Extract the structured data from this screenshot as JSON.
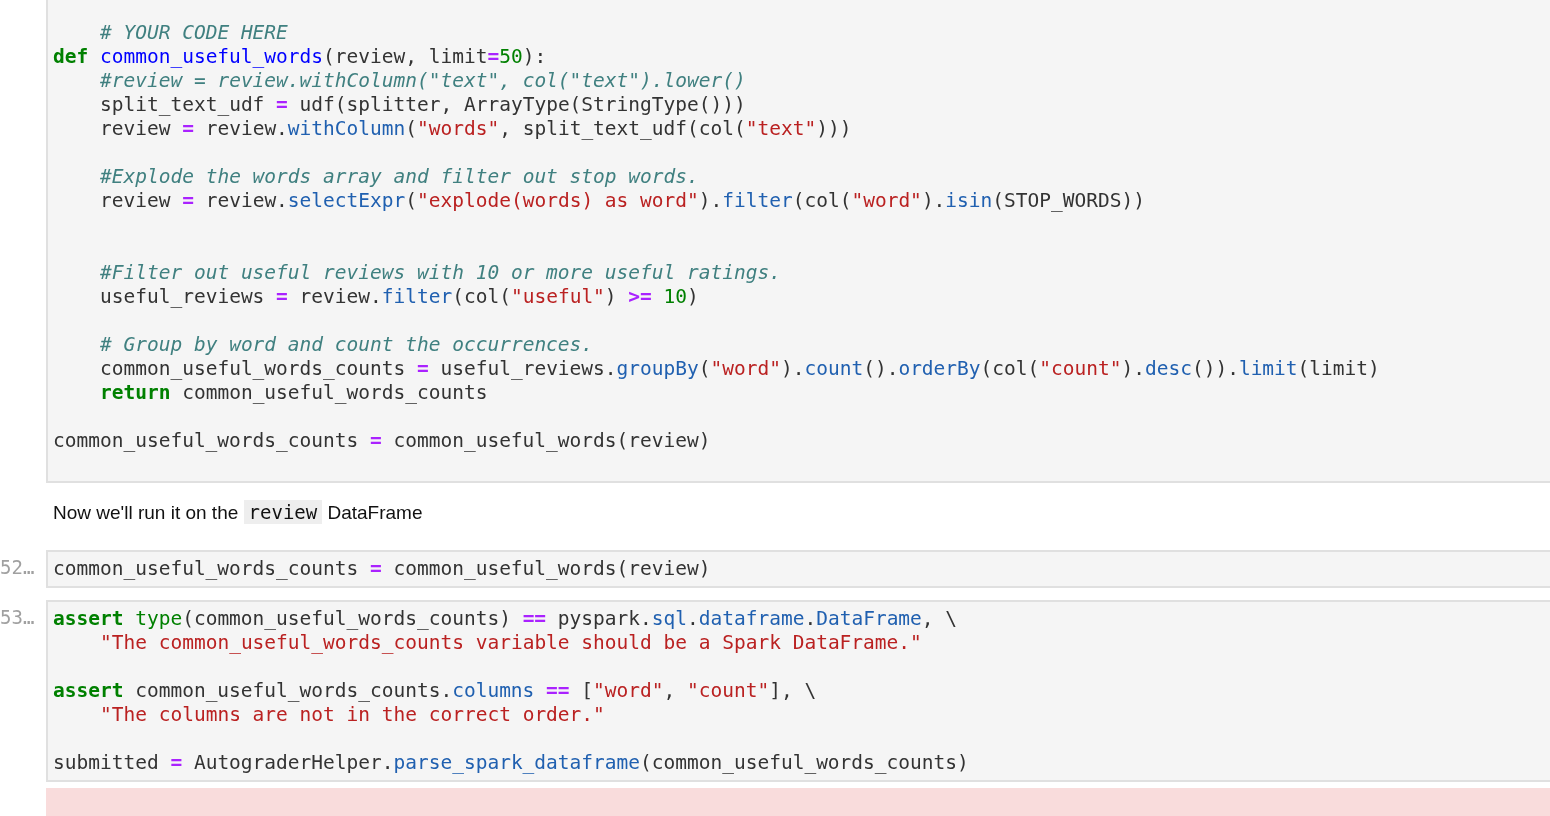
{
  "cells": [
    {
      "kind": "code",
      "lines": [
        {
          "kind": "indented",
          "tokens": [
            {
              "kind": "cmt",
              "text": "# YOUR CODE HERE"
            }
          ]
        },
        {
          "kind": "code",
          "tokens": [
            {
              "kind": "kw",
              "text": "def "
            },
            {
              "kind": "fn",
              "text": "common_useful_words"
            },
            {
              "kind": "plain",
              "text": "(review, limit"
            },
            {
              "kind": "op",
              "text": "="
            },
            {
              "kind": "num",
              "text": "50"
            },
            {
              "kind": "plain",
              "text": "):"
            }
          ]
        },
        {
          "kind": "indented",
          "tokens": [
            {
              "kind": "cmt",
              "text": "#review = review.withColumn(\"text\", col(\"text\").lower()"
            }
          ]
        },
        {
          "kind": "indented",
          "tokens": [
            {
              "kind": "plain",
              "text": "split_text_udf "
            },
            {
              "kind": "op",
              "text": "="
            },
            {
              "kind": "plain",
              "text": " udf(splitter, ArrayType(StringType()))"
            }
          ]
        },
        {
          "kind": "indented",
          "tokens": [
            {
              "kind": "plain",
              "text": "review "
            },
            {
              "kind": "op",
              "text": "="
            },
            {
              "kind": "plain",
              "text": " review."
            },
            {
              "kind": "attr",
              "text": "withColumn"
            },
            {
              "kind": "plain",
              "text": "("
            },
            {
              "kind": "str",
              "text": "\"words\""
            },
            {
              "kind": "plain",
              "text": ", split_text_udf(col("
            },
            {
              "kind": "str",
              "text": "\"text\""
            },
            {
              "kind": "plain",
              "text": ")))"
            }
          ]
        },
        {
          "kind": "blank"
        },
        {
          "kind": "indented",
          "tokens": [
            {
              "kind": "cmt",
              "text": "#Explode the words array and filter out stop words."
            }
          ]
        },
        {
          "kind": "indented",
          "tokens": [
            {
              "kind": "plain",
              "text": "review "
            },
            {
              "kind": "op",
              "text": "="
            },
            {
              "kind": "plain",
              "text": " review."
            },
            {
              "kind": "attr",
              "text": "selectExpr"
            },
            {
              "kind": "plain",
              "text": "("
            },
            {
              "kind": "str",
              "text": "\"explode(words) as word\""
            },
            {
              "kind": "plain",
              "text": ")."
            },
            {
              "kind": "attr",
              "text": "filter"
            },
            {
              "kind": "plain",
              "text": "(col("
            },
            {
              "kind": "str",
              "text": "\"word\""
            },
            {
              "kind": "plain",
              "text": ")."
            },
            {
              "kind": "attr",
              "text": "isin"
            },
            {
              "kind": "plain",
              "text": "(STOP_WORDS))"
            }
          ]
        },
        {
          "kind": "blank"
        },
        {
          "kind": "blank"
        },
        {
          "kind": "indented",
          "tokens": [
            {
              "kind": "cmt",
              "text": "#Filter out useful reviews with 10 or more useful ratings."
            }
          ]
        },
        {
          "kind": "indented",
          "tokens": [
            {
              "kind": "plain",
              "text": "useful_reviews "
            },
            {
              "kind": "op",
              "text": "="
            },
            {
              "kind": "plain",
              "text": " review."
            },
            {
              "kind": "attr",
              "text": "filter"
            },
            {
              "kind": "plain",
              "text": "(col("
            },
            {
              "kind": "str",
              "text": "\"useful\""
            },
            {
              "kind": "plain",
              "text": ") "
            },
            {
              "kind": "op",
              "text": ">= "
            },
            {
              "kind": "num",
              "text": "10"
            },
            {
              "kind": "plain",
              "text": ")"
            }
          ]
        },
        {
          "kind": "blank"
        },
        {
          "kind": "indented",
          "tokens": [
            {
              "kind": "cmt",
              "text": "# Group by word and count the occurrences."
            }
          ]
        },
        {
          "kind": "indented",
          "tokens": [
            {
              "kind": "plain",
              "text": "common_useful_words_counts "
            },
            {
              "kind": "op",
              "text": "="
            },
            {
              "kind": "plain",
              "text": " useful_reviews."
            },
            {
              "kind": "attr",
              "text": "groupBy"
            },
            {
              "kind": "plain",
              "text": "("
            },
            {
              "kind": "str",
              "text": "\"word\""
            },
            {
              "kind": "plain",
              "text": ")."
            },
            {
              "kind": "attr",
              "text": "count"
            },
            {
              "kind": "plain",
              "text": "()."
            },
            {
              "kind": "attr",
              "text": "orderBy"
            },
            {
              "kind": "plain",
              "text": "(col("
            },
            {
              "kind": "str",
              "text": "\"count\""
            },
            {
              "kind": "plain",
              "text": ")."
            },
            {
              "kind": "attr",
              "text": "desc"
            },
            {
              "kind": "plain",
              "text": "())."
            },
            {
              "kind": "attr",
              "text": "limit"
            },
            {
              "kind": "plain",
              "text": "(limit)"
            }
          ]
        },
        {
          "kind": "indented",
          "tokens": [
            {
              "kind": "kw",
              "text": "return "
            },
            {
              "kind": "plain",
              "text": "common_useful_words_counts"
            }
          ]
        },
        {
          "kind": "blank"
        },
        {
          "kind": "code",
          "tokens": [
            {
              "kind": "plain",
              "text": "common_useful_words_counts "
            },
            {
              "kind": "op",
              "text": "="
            },
            {
              "kind": "plain",
              "text": " common_useful_words(review)"
            }
          ]
        }
      ]
    },
    {
      "kind": "markdown",
      "parts": [
        {
          "kind": "text",
          "text": "Now we'll run it on the "
        },
        {
          "kind": "code",
          "text": "review"
        },
        {
          "kind": "text",
          "text": " DataFrame"
        }
      ]
    },
    {
      "kind": "code",
      "prompt": "52…",
      "lines": [
        {
          "kind": "code",
          "tokens": [
            {
              "kind": "plain",
              "text": "common_useful_words_counts "
            },
            {
              "kind": "op",
              "text": "="
            },
            {
              "kind": "plain",
              "text": " common_useful_words(review)"
            }
          ]
        }
      ]
    },
    {
      "kind": "code",
      "prompt": "53…",
      "lines": [
        {
          "kind": "code",
          "tokens": [
            {
              "kind": "kw",
              "text": "assert "
            },
            {
              "kind": "builtin",
              "text": "type"
            },
            {
              "kind": "plain",
              "text": "(common_useful_words_counts) "
            },
            {
              "kind": "op",
              "text": "=="
            },
            {
              "kind": "plain",
              "text": " pyspark."
            },
            {
              "kind": "attr",
              "text": "sql"
            },
            {
              "kind": "plain",
              "text": "."
            },
            {
              "kind": "attr",
              "text": "dataframe"
            },
            {
              "kind": "plain",
              "text": "."
            },
            {
              "kind": "attr",
              "text": "DataFrame"
            },
            {
              "kind": "plain",
              "text": ", \\"
            }
          ]
        },
        {
          "kind": "indented",
          "tokens": [
            {
              "kind": "str",
              "text": "\"The common_useful_words_counts variable should be a Spark DataFrame.\""
            }
          ]
        },
        {
          "kind": "blank"
        },
        {
          "kind": "code",
          "tokens": [
            {
              "kind": "kw",
              "text": "assert "
            },
            {
              "kind": "plain",
              "text": "common_useful_words_counts."
            },
            {
              "kind": "attr",
              "text": "columns "
            },
            {
              "kind": "op",
              "text": "=="
            },
            {
              "kind": "plain",
              "text": " ["
            },
            {
              "kind": "str",
              "text": "\"word\""
            },
            {
              "kind": "plain",
              "text": ", "
            },
            {
              "kind": "str",
              "text": "\"count\""
            },
            {
              "kind": "plain",
              "text": "], \\"
            }
          ]
        },
        {
          "kind": "indented",
          "tokens": [
            {
              "kind": "str",
              "text": "\"The columns are not in the correct order.\""
            }
          ]
        },
        {
          "kind": "blank"
        },
        {
          "kind": "code",
          "tokens": [
            {
              "kind": "plain",
              "text": "submitted "
            },
            {
              "kind": "op",
              "text": "="
            },
            {
              "kind": "plain",
              "text": " AutograderHelper."
            },
            {
              "kind": "attr",
              "text": "parse_spark_dataframe"
            },
            {
              "kind": "plain",
              "text": "(common_useful_words_counts)"
            }
          ]
        }
      ]
    },
    {
      "kind": "error"
    }
  ]
}
